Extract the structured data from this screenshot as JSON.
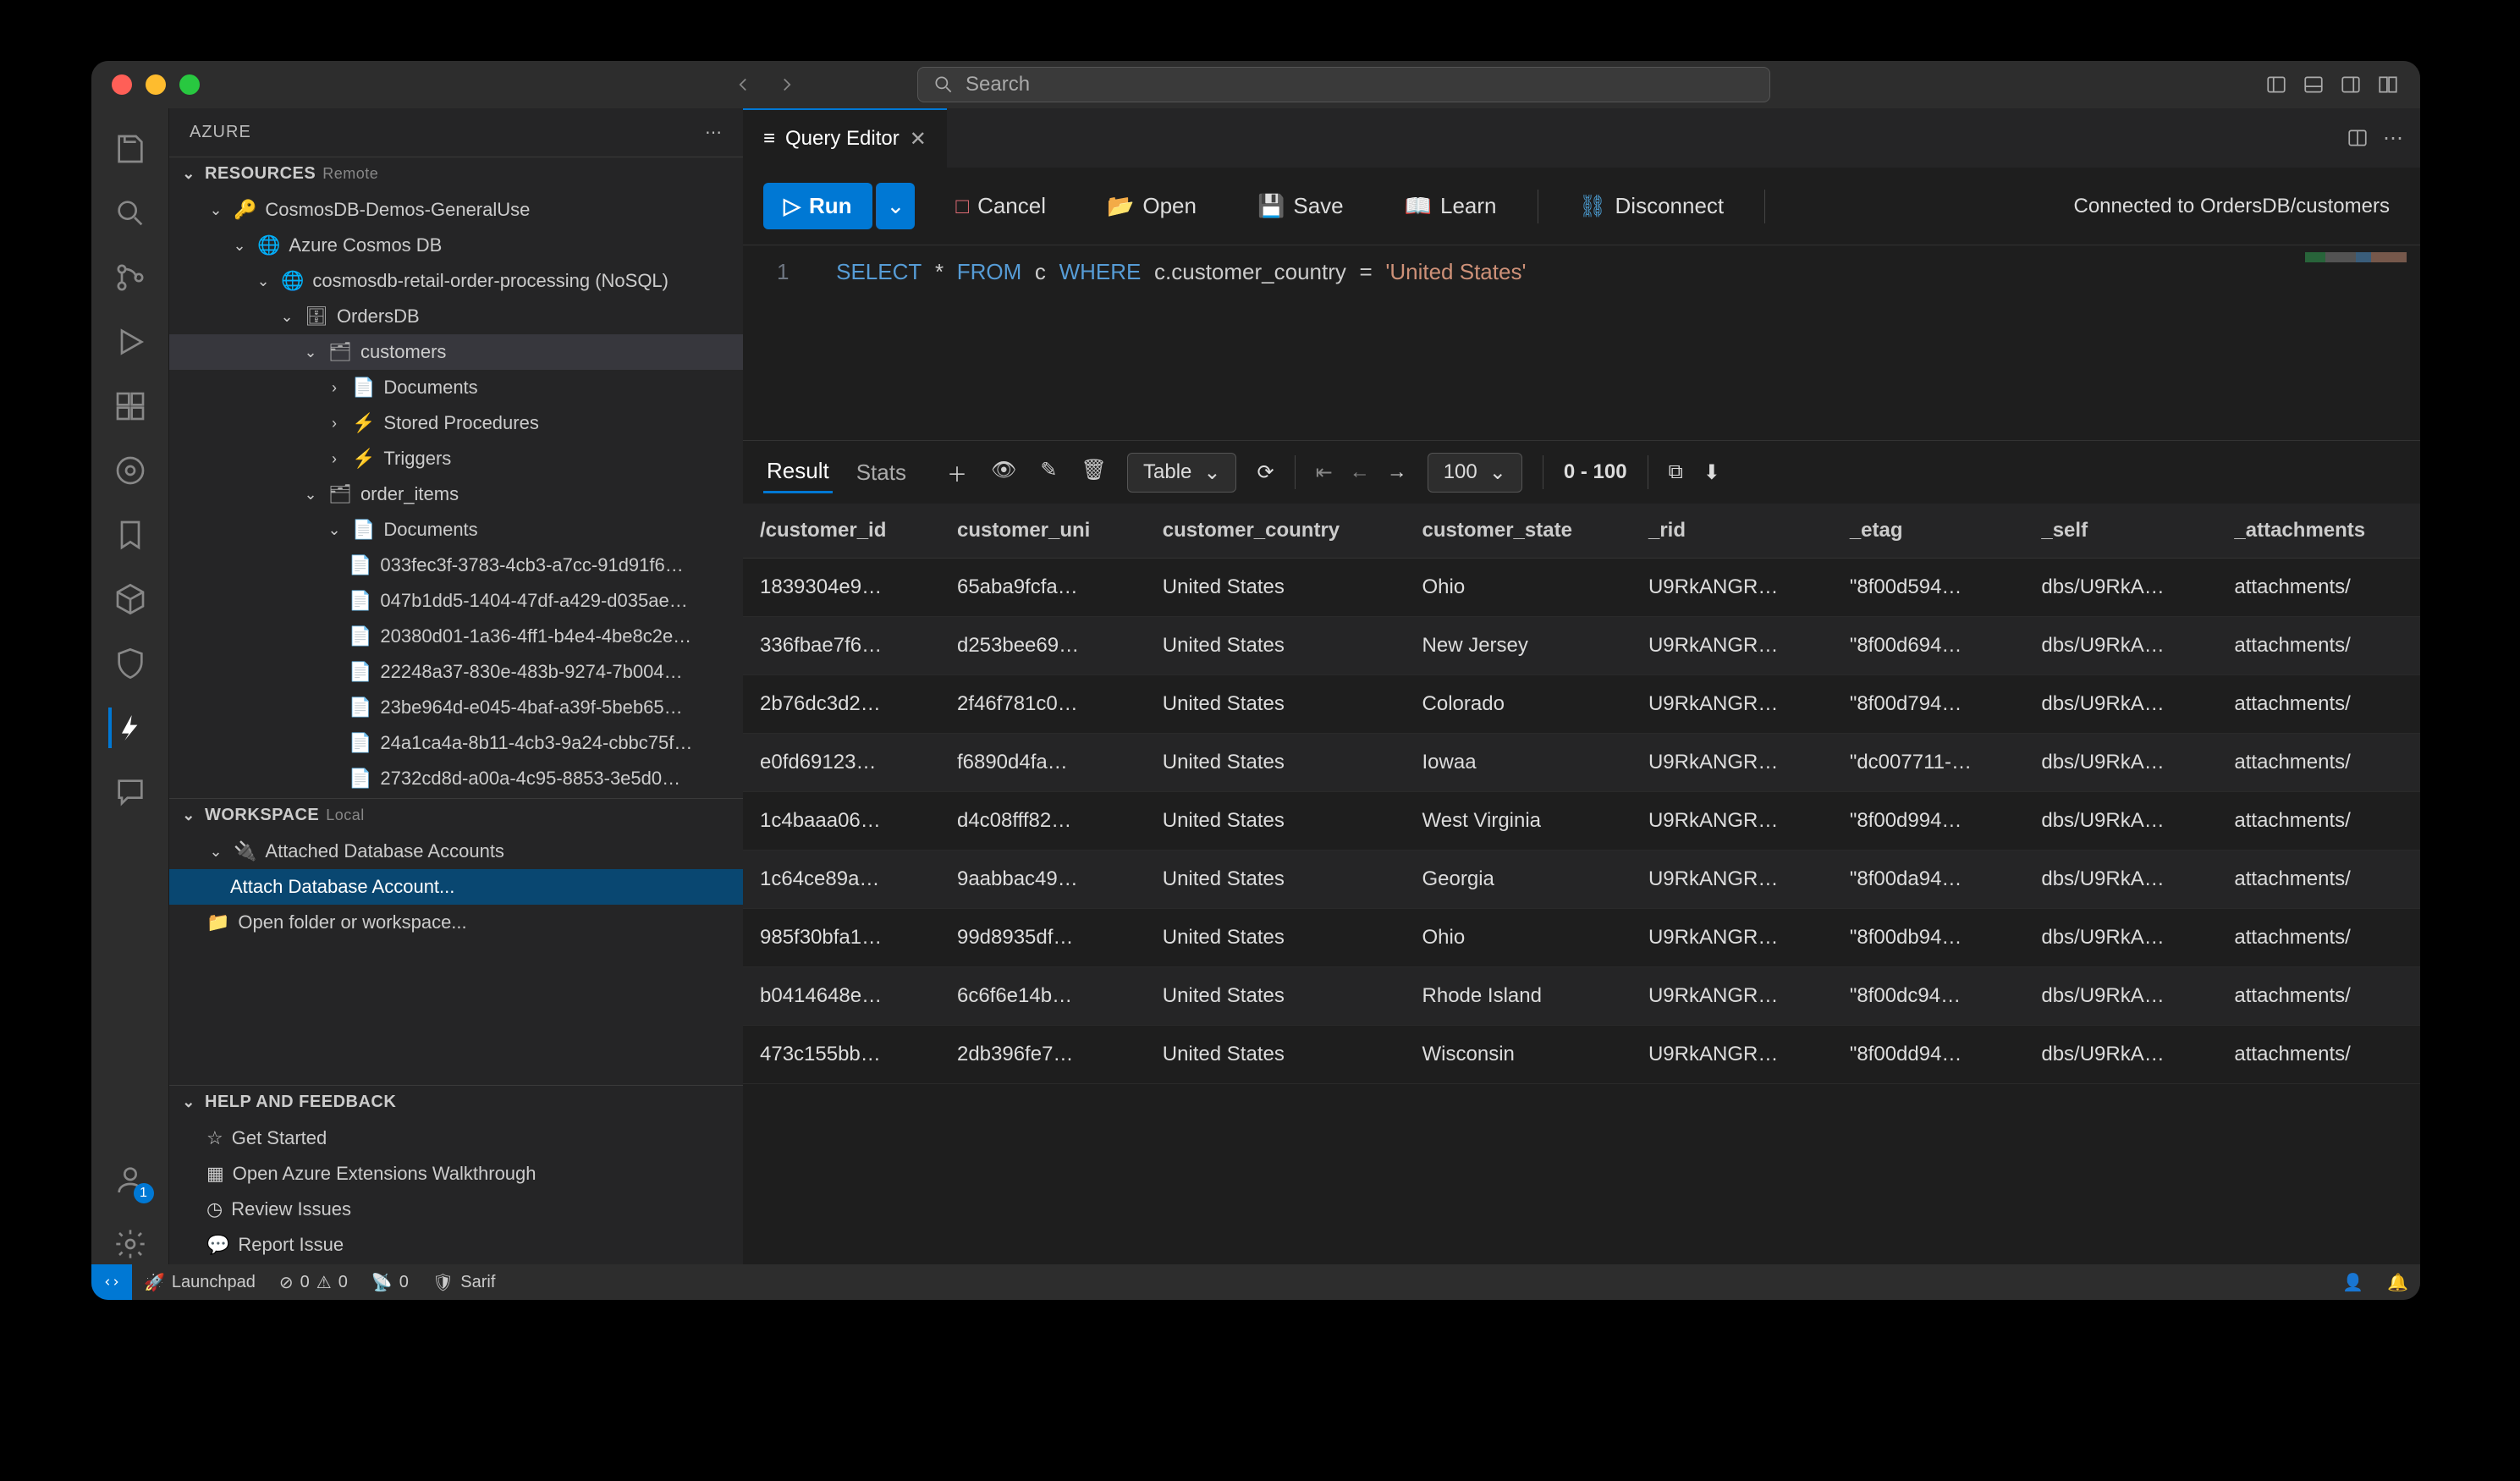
{
  "titlebar": {
    "search_placeholder": "Search"
  },
  "sidebar": {
    "title": "AZURE",
    "sections": {
      "resources": {
        "label": "RESOURCES",
        "badge": "Remote"
      },
      "workspace": {
        "label": "WORKSPACE",
        "badge": "Local"
      },
      "help": {
        "label": "HELP AND FEEDBACK"
      }
    },
    "tree": {
      "sub": "CosmosDB-Demos-GeneralUse",
      "service": "Azure Cosmos DB",
      "account": "cosmosdb-retail-order-processing (NoSQL)",
      "db": "OrdersDB",
      "containers": {
        "customers": {
          "label": "customers",
          "children": [
            "Documents",
            "Stored Procedures",
            "Triggers"
          ]
        },
        "order_items": {
          "label": "order_items",
          "docs_label": "Documents",
          "docs": [
            "033fec3f-3783-4cb3-a7cc-91d91f6…",
            "047b1dd5-1404-47df-a429-d035ae…",
            "20380d01-1a36-4ff1-b4e4-4be8c2e…",
            "22248a37-830e-483b-9274-7b004…",
            "23be964d-e045-4baf-a39f-5beb65…",
            "24a1ca4a-8b11-4cb3-9a24-cbbc75f…",
            "2732cd8d-a00a-4c95-8853-3e5d0…"
          ]
        }
      }
    },
    "workspace": {
      "attached": "Attached Database Accounts",
      "attach": "Attach Database Account...",
      "open_folder": "Open folder or workspace..."
    },
    "help": [
      "Get Started",
      "Open Azure Extensions Walkthrough",
      "Review Issues",
      "Report Issue"
    ]
  },
  "editor": {
    "tab": "Query Editor"
  },
  "toolbar": {
    "run": "Run",
    "cancel": "Cancel",
    "open": "Open",
    "save": "Save",
    "learn": "Learn",
    "disconnect": "Disconnect",
    "status": "Connected to OrdersDB/customers"
  },
  "query": {
    "lineno": "1",
    "sql_select": "SELECT",
    "sql_star": "*",
    "sql_from": "FROM",
    "sql_c": "c",
    "sql_where": "WHERE",
    "sql_field": "c.customer_country",
    "sql_eq": "=",
    "sql_val": "'United States'"
  },
  "results": {
    "tabs": {
      "result": "Result",
      "stats": "Stats"
    },
    "view": "Table",
    "pagesize": "100",
    "range": "0 - 100",
    "columns": [
      "/customer_id",
      "customer_uni",
      "customer_country",
      "customer_state",
      "_rid",
      "_etag",
      "_self",
      "_attachments"
    ],
    "rows": [
      [
        "1839304e9…",
        "65aba9fcfa…",
        "United States",
        "Ohio",
        "U9RkANGR…",
        "\"8f00d594…",
        "dbs/U9RkA…",
        "attachments/"
      ],
      [
        "336fbae7f6…",
        "d253bee69…",
        "United States",
        "New Jersey",
        "U9RkANGR…",
        "\"8f00d694…",
        "dbs/U9RkA…",
        "attachments/"
      ],
      [
        "2b76dc3d2…",
        "2f46f781c0…",
        "United States",
        "Colorado",
        "U9RkANGR…",
        "\"8f00d794…",
        "dbs/U9RkA…",
        "attachments/"
      ],
      [
        "e0fd69123…",
        "f6890d4fa…",
        "United States",
        "Iowaa",
        "U9RkANGR…",
        "\"dc007711-…",
        "dbs/U9RkA…",
        "attachments/"
      ],
      [
        "1c4baaa06…",
        "d4c08fff82…",
        "United States",
        "West Virginia",
        "U9RkANGR…",
        "\"8f00d994…",
        "dbs/U9RkA…",
        "attachments/"
      ],
      [
        "1c64ce89a…",
        "9aabbac49…",
        "United States",
        "Georgia",
        "U9RkANGR…",
        "\"8f00da94…",
        "dbs/U9RkA…",
        "attachments/"
      ],
      [
        "985f30bfa1…",
        "99d8935df…",
        "United States",
        "Ohio",
        "U9RkANGR…",
        "\"8f00db94…",
        "dbs/U9RkA…",
        "attachments/"
      ],
      [
        "b0414648e…",
        "6c6f6e14b…",
        "United States",
        "Rhode Island",
        "U9RkANGR…",
        "\"8f00dc94…",
        "dbs/U9RkA…",
        "attachments/"
      ],
      [
        "473c155bb…",
        "2db396fe7…",
        "United States",
        "Wisconsin",
        "U9RkANGR…",
        "\"8f00dd94…",
        "dbs/U9RkA…",
        "attachments/"
      ]
    ]
  },
  "statusbar": {
    "launchpad": "Launchpad",
    "errors": "0",
    "warnings": "0",
    "ports": "0",
    "sarif": "Sarif"
  }
}
